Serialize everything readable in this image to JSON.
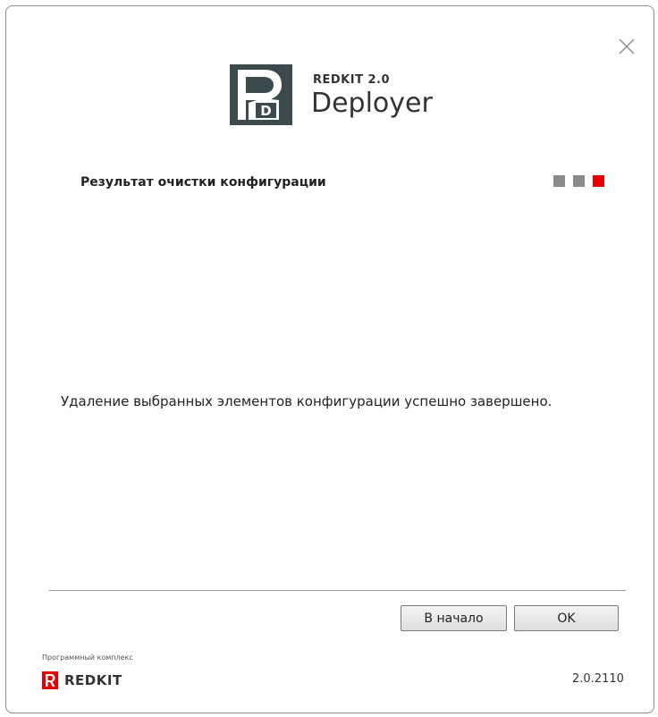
{
  "header": {
    "brand_small": "REDKIT 2.0",
    "brand_big": "Deployer",
    "logo_icon": "redkit-deployer-logo",
    "close_icon": "close-icon"
  },
  "step": {
    "title": "Результат очистки конфигурации",
    "indicators": [
      {
        "state": "done",
        "color": "#8a8a8a"
      },
      {
        "state": "done",
        "color": "#8a8a8a"
      },
      {
        "state": "active",
        "color": "#e60000"
      }
    ]
  },
  "main": {
    "message": "Удаление выбранных элементов конфигурации успешно завершено."
  },
  "buttons": {
    "home_label": "В начало",
    "ok_label": "OK"
  },
  "footer": {
    "label": "Программный комплекс",
    "brand": "REDKIT",
    "brand_color": "#e60000",
    "version": "2.0.2110"
  }
}
